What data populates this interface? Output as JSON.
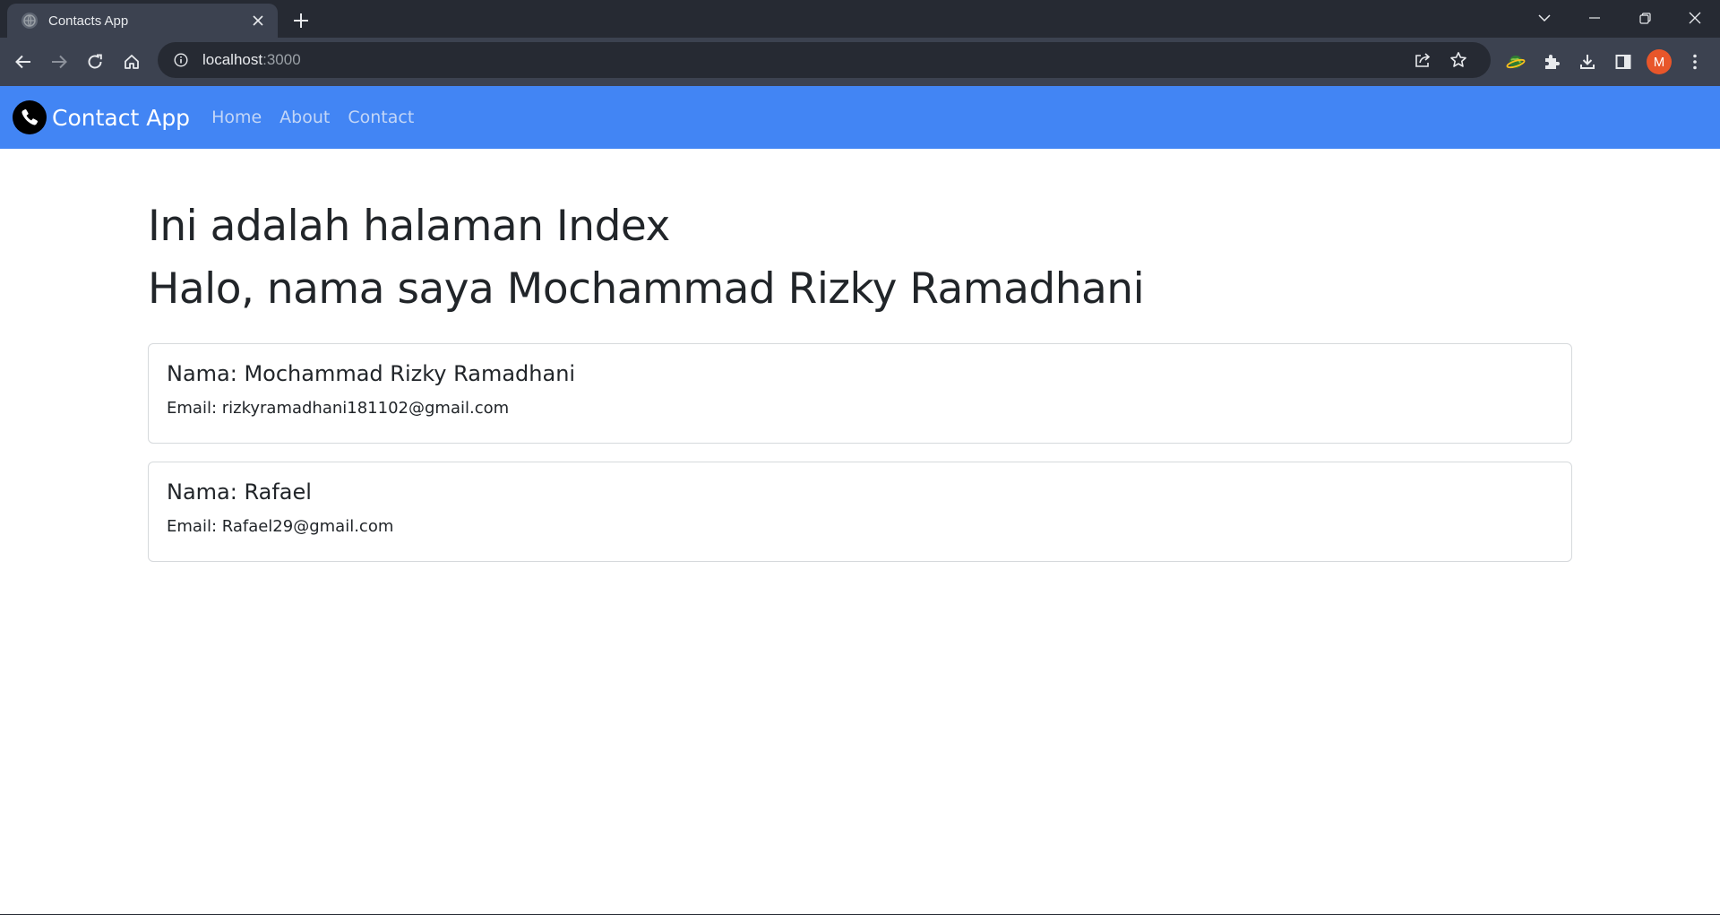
{
  "browser": {
    "tab": {
      "title": "Contacts App",
      "favicon": "globe-icon"
    },
    "address": {
      "host": "localhost",
      "port": ":3000"
    },
    "profile_initial": "M"
  },
  "navbar": {
    "brand": "Contact App",
    "brand_icon": "phone-icon",
    "links": [
      {
        "label": "Home"
      },
      {
        "label": "About"
      },
      {
        "label": "Contact"
      }
    ],
    "color": "#4285f4"
  },
  "main": {
    "heading_1": "Ini adalah halaman Index",
    "heading_2": "Halo, nama saya Mochammad Rizky Ramadhani",
    "contacts": [
      {
        "name": "Nama: Mochammad Rizky Ramadhani",
        "email": "Email: rizkyramadhani181102@gmail.com"
      },
      {
        "name": "Nama: Rafael",
        "email": "Email: Rafael29@gmail.com"
      }
    ]
  }
}
